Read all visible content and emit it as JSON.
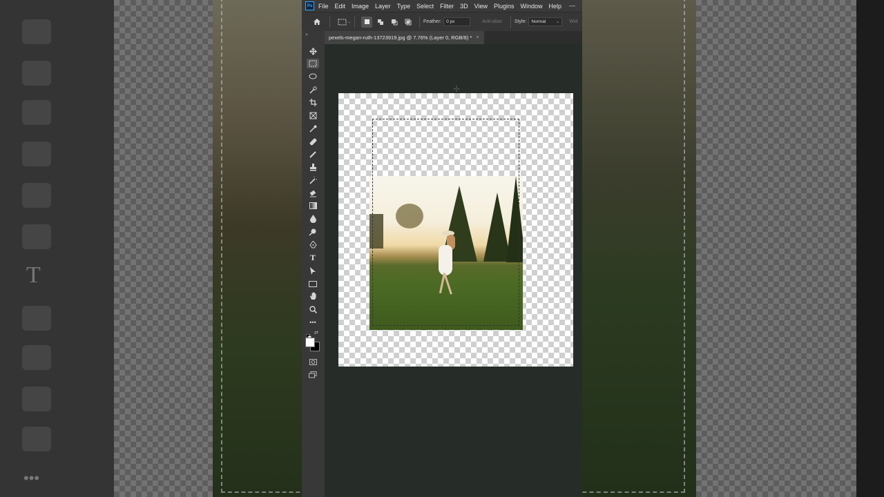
{
  "app": {
    "menu": [
      "File",
      "Edit",
      "Image",
      "Layer",
      "Type",
      "Select",
      "Filter",
      "3D",
      "View",
      "Plugins",
      "Window",
      "Help"
    ],
    "logo_text": "Ps"
  },
  "options": {
    "feather_label": "Feather:",
    "feather_value": "0 px",
    "antialias_label": "Anti-alias",
    "style_label": "Style:",
    "style_value": "Normal",
    "width_label": "Wid"
  },
  "document": {
    "tab_title": "pexels-megan-ruth-13723919.jpg @ 7.76% (Layer 0, RGB/8) *",
    "close_glyph": "×"
  },
  "tools": [
    "move",
    "rectangular-marquee",
    "lasso",
    "quick-selection",
    "crop",
    "frame",
    "eyedropper",
    "healing-brush",
    "brush",
    "clone-stamp",
    "history-brush",
    "eraser",
    "gradient",
    "blur",
    "dodge",
    "pen",
    "type",
    "path-selection",
    "rectangle",
    "hand",
    "zoom",
    "more"
  ],
  "colors": {
    "app_bg": "#282e29",
    "menubar": "#3a3a3a",
    "panel": "#383838",
    "foreground_swatch": "#ffffff",
    "background_swatch": "#000000"
  }
}
